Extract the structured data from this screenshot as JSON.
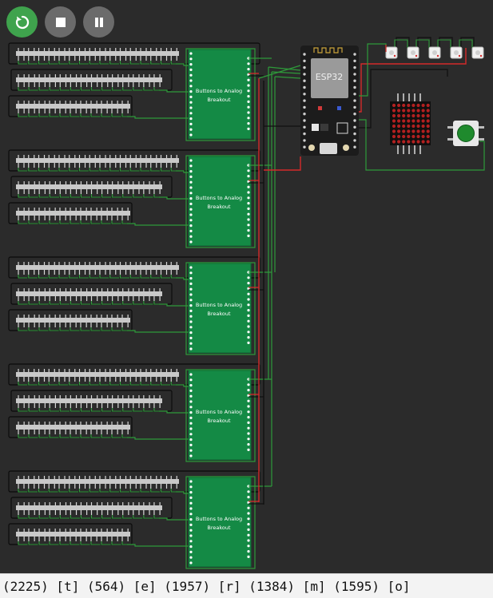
{
  "toolbar": {
    "restart_icon": "restart-icon",
    "stop_icon": "stop-icon",
    "pause_icon": "pause-icon",
    "restart_color": "#3fa34d",
    "inactive_color": "#6b6b6b"
  },
  "board": {
    "label": "ESP32"
  },
  "breakouts": [
    {
      "line1": "Buttons to Analog",
      "line2": "Breakout"
    },
    {
      "line1": "Buttons to Analog",
      "line2": "Breakout"
    },
    {
      "line1": "Buttons to Analog",
      "line2": "Breakout"
    },
    {
      "line1": "Buttons to Analog",
      "line2": "Breakout"
    },
    {
      "line1": "Buttons to Analog",
      "line2": "Breakout"
    }
  ],
  "serial_monitor": {
    "text": "(2225) [t] (564) [e] (1957) [r] (1384) [m] (1595) [o]"
  },
  "colors": {
    "canvas": "#2b2b2b",
    "breakout_green": "#148a45",
    "wire_green": "#2e9a3a",
    "wire_red": "#d42a2a",
    "keyboard_bar": "#c9c9c9"
  }
}
